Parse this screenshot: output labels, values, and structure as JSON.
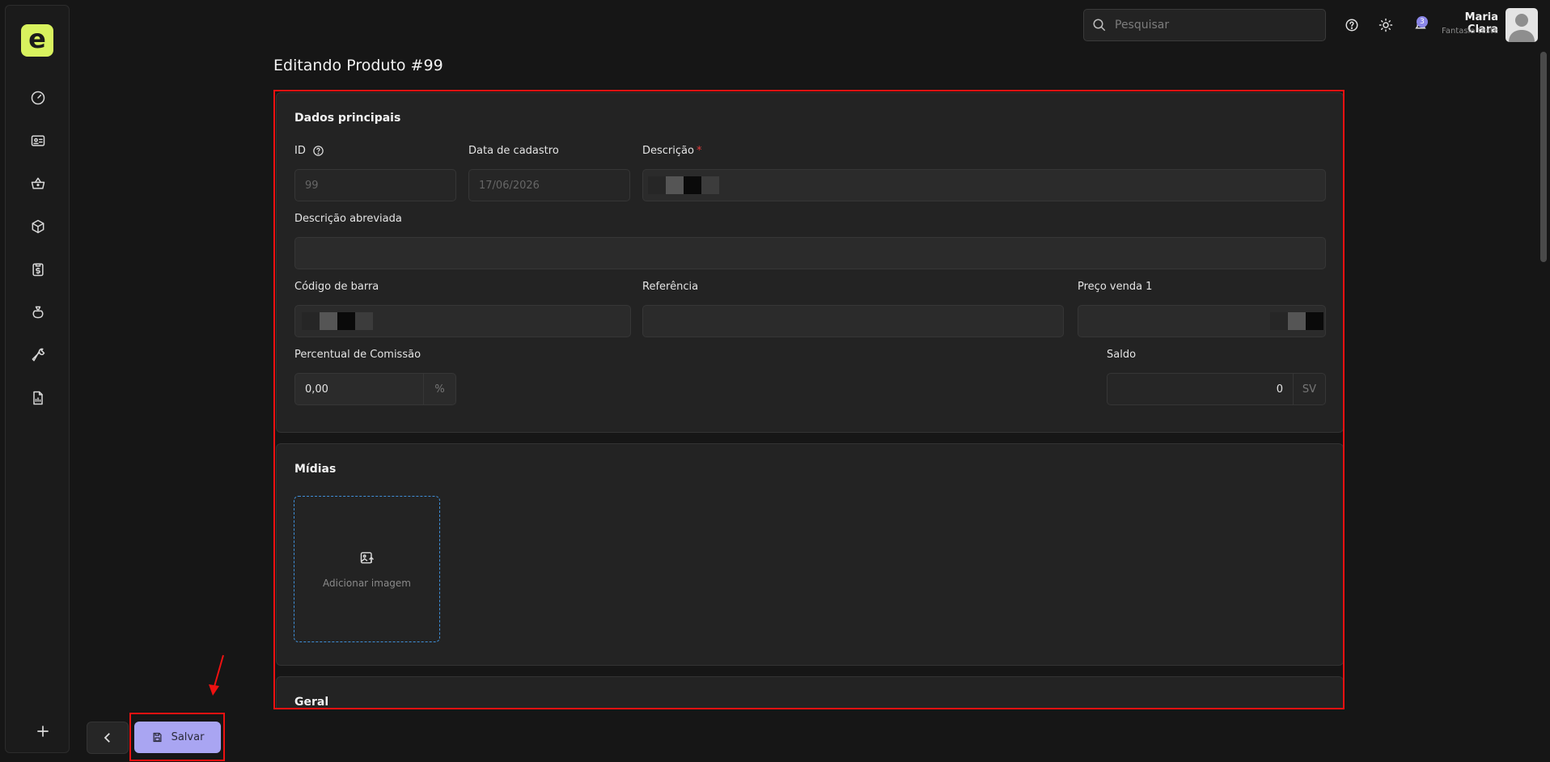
{
  "sidebar": {
    "logo_letter": "e",
    "items": [
      {
        "icon": "dashboard-gauge-icon"
      },
      {
        "icon": "id-card-icon"
      },
      {
        "icon": "shopping-basket-icon"
      },
      {
        "icon": "box-icon"
      },
      {
        "icon": "clipboard-dollar-icon"
      },
      {
        "icon": "money-bag-icon"
      },
      {
        "icon": "wrench-icon"
      },
      {
        "icon": "report-chart-icon"
      }
    ],
    "add_icon": "plus-icon"
  },
  "header": {
    "search_placeholder": "Pesquisar",
    "notification_count": "3",
    "user_name": "Maria Clara",
    "user_company": "Fantasia teste"
  },
  "page": {
    "title": "Editando Produto #99"
  },
  "form": {
    "main_section": {
      "title": "Dados principais",
      "id_label": "ID",
      "id_value": "99",
      "date_label": "Data de cadastro",
      "date_value": "17/06/2026",
      "description_label": "Descrição",
      "description_required": "*",
      "short_description_label": "Descrição abreviada",
      "barcode_label": "Código de barra",
      "reference_label": "Referência",
      "price_label": "Preço venda 1",
      "commission_label": "Percentual de Comissão",
      "commission_value": "0,00",
      "commission_unit": "%",
      "balance_label": "Saldo",
      "balance_value": "0",
      "balance_unit": "SV"
    },
    "media_section": {
      "title": "Mídias",
      "add_image_label": "Adicionar imagem"
    },
    "general_section": {
      "title": "Geral"
    }
  },
  "footer": {
    "save_label": "Salvar"
  },
  "colors": {
    "accent": "#a9a5f2",
    "logo": "#d8f25e",
    "highlight": "#ee1111",
    "background": "#161616"
  }
}
